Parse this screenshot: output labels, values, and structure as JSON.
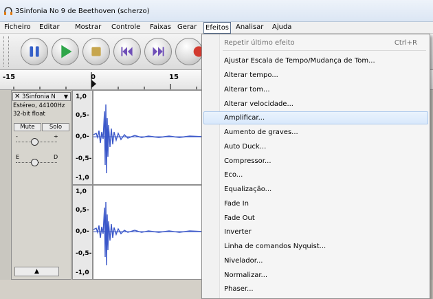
{
  "window": {
    "title": "3Sinfonia No 9 de Beethoven (scherzo)"
  },
  "menubar": {
    "items": [
      "Ficheiro",
      "Editar",
      "Mostrar",
      "Controle",
      "Faixas",
      "Gerar",
      "Efeitos",
      "Analisar",
      "Ajuda"
    ],
    "active": "Efeitos"
  },
  "toolbar": {
    "buttons": [
      "pause-icon",
      "play-icon",
      "stop-icon",
      "skip-start-icon",
      "skip-end-icon",
      "record-icon"
    ]
  },
  "ruler": {
    "labels": [
      "-15",
      "0",
      "15"
    ]
  },
  "track": {
    "name": "3Sinfonia N",
    "rate": "Estéreo, 44100Hz",
    "format": "32-bit float",
    "mute_label": "Mute",
    "solo_label": "Solo",
    "gain_minus": "-",
    "gain_plus": "+",
    "pan_left": "E",
    "pan_right": "D",
    "collapse_symbol": "▲"
  },
  "vscale": {
    "labels": [
      "1,0",
      "0,5-",
      "0,0-",
      "-0,5-",
      "-1,0"
    ]
  },
  "effects_menu": {
    "repeat_label": "Repetir último efeito",
    "repeat_shortcut": "Ctrl+R",
    "items": [
      "Ajustar Escala de Tempo/Mudança de Tom...",
      "Alterar tempo...",
      "Alterar tom...",
      "Alterar velocidade...",
      "Amplificar...",
      "Aumento de graves...",
      "Auto Duck...",
      "Compressor...",
      "Eco...",
      "Equalização...",
      "Fade In",
      "Fade Out",
      "Inverter",
      "Linha de comandos Nyquist...",
      "Nivelador...",
      "Normalizar...",
      "Phaser..."
    ],
    "highlighted": "Amplificar..."
  },
  "colors": {
    "waveform": "#3a57c9",
    "menu_highlight": "#d8e8fb",
    "record": "#d23a2f",
    "play": "#2fa64a"
  }
}
